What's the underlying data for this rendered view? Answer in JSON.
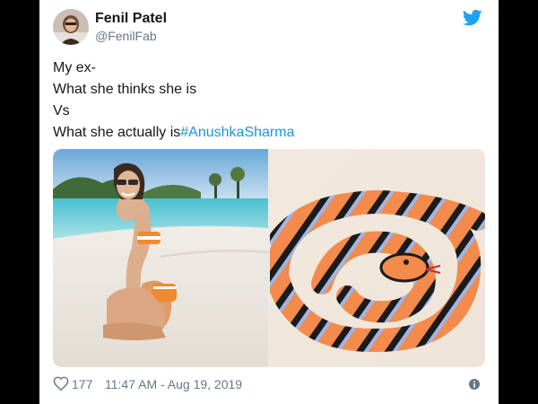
{
  "tweet": {
    "author": {
      "name": "Fenil Patel",
      "handle": "@FenilFab"
    },
    "text_lines": [
      "My ex-",
      "What she thinks she is",
      "Vs",
      "What she actually is"
    ],
    "hashtag": "#AnushkaSharma",
    "media": [
      {
        "subject": "woman-on-beach-photo"
      },
      {
        "subject": "toy-snake-photo"
      }
    ],
    "likes_count": "177",
    "timestamp": "11:47 AM - Aug 19, 2019",
    "icons": {
      "brand": "twitter-bird-icon",
      "like": "heart-icon",
      "info": "info-icon"
    },
    "colors": {
      "accent": "#1da1f2",
      "hashtag": "#1b95e0",
      "text": "#14171a",
      "muted": "#657786"
    }
  }
}
